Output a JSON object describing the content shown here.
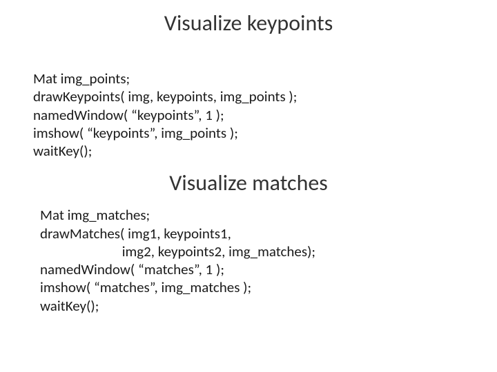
{
  "headings": {
    "keypoints": "Visualize keypoints",
    "matches": "Visualize matches"
  },
  "code_keypoints": {
    "line1": "Mat img_points;",
    "line2": "drawKeypoints( img, keypoints, img_points );",
    "line3": "namedWindow( “keypoints”, 1 );",
    "line4": "imshow( “keypoints”, img_points );",
    "line5": "waitKey();"
  },
  "code_matches": {
    "line1": "Mat img_matches;",
    "line2": "drawMatches( img1, keypoints1,",
    "line3": "                         img2, keypoints2, img_matches);",
    "line4": "namedWindow( “matches”, 1 );",
    "line5": "imshow( “matches”, img_matches );",
    "line6": "waitKey();"
  }
}
